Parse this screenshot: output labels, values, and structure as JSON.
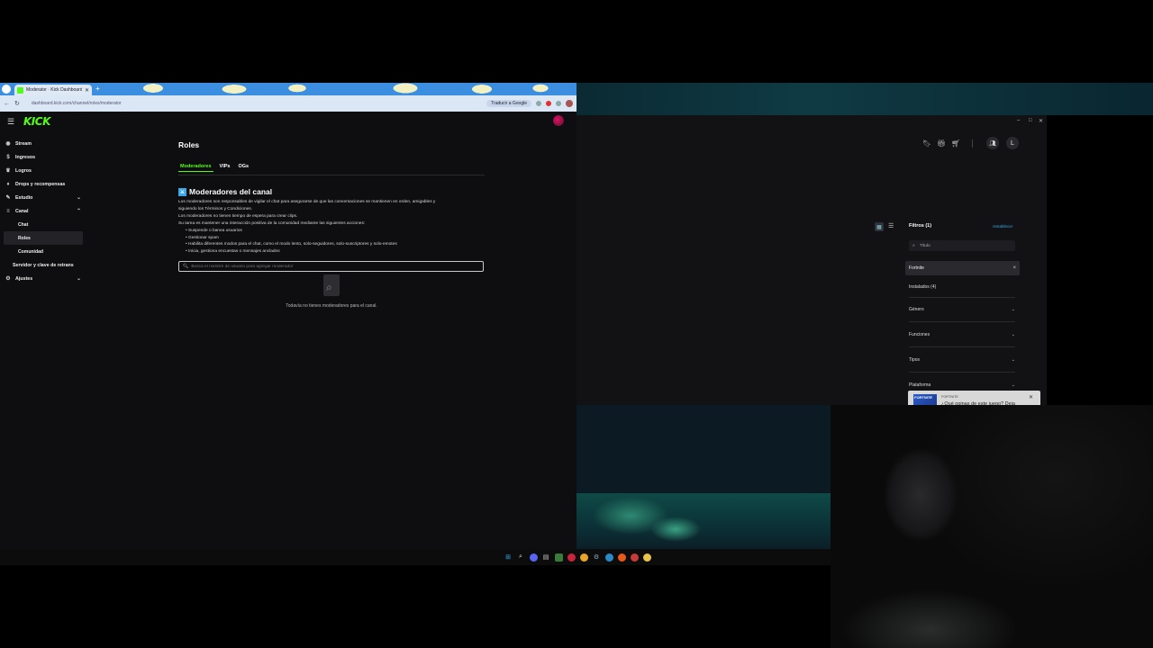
{
  "browser": {
    "tab_title": "Moderator · Kick Dashboard",
    "url": "dashboard.kick.com/channel/roles/moderator",
    "translate_button": "Traducir a Google"
  },
  "kick": {
    "logo": "KICK",
    "sidebar": [
      {
        "label": "Stream",
        "icon": "stream-icon",
        "glyph": "((·))"
      },
      {
        "label": "Ingresos",
        "icon": "money-icon",
        "glyph": "$"
      },
      {
        "label": "Logros",
        "icon": "trophy-icon",
        "glyph": "♛"
      },
      {
        "label": "Drops y recompensas",
        "icon": "gift-icon",
        "glyph": "♦"
      },
      {
        "label": "Estudio",
        "icon": "studio-icon",
        "glyph": "✎"
      },
      {
        "label": "Canal",
        "icon": "channel-icon",
        "glyph": "≡"
      },
      {
        "label": "Chat"
      },
      {
        "label": "Roles"
      },
      {
        "label": "Comunidad"
      },
      {
        "label": "Servidor y clave de retrans"
      },
      {
        "label": "Ajustes",
        "icon": "settings-icon",
        "glyph": "⚙"
      }
    ],
    "page_title": "Roles",
    "tabs": [
      "Moderadores",
      "VIPs",
      "OGs"
    ],
    "section_title": "Moderadores del canal",
    "desc_lines": [
      "Los moderadores son responsables de vigilar el chat para asegurarse de que las conversaciones se mantienen en orden, amigables y",
      "siguiendo los Términos y Condiciones.",
      "Los moderadores no tienen tiempo de espera para crear clips.",
      "Su tarea es mantener una interacción positiva de la comunidad mediante las siguientes acciones:"
    ],
    "bullets": [
      "Suspende o banea usuarios",
      "Gestionar spam",
      "Habilita diferentes modos para el chat, como el modo lento, solo-seguidores, solo-suscriptores y solo-emotes",
      "Inicia, gestiona encuestas o mensajes anclados"
    ],
    "search_placeholder": "Busca el nombre de usuario para agregar moderador",
    "empty_text": "Todavía no tienes moderadores para el canal."
  },
  "launcher": {
    "user_initial": "L",
    "filters_title": "Filtros (1)",
    "reset_label": "restablecer",
    "title_search_placeholder": "Título",
    "active_filter": "Fortnite",
    "installed": "Instalados (4)",
    "filter_groups": [
      "Género",
      "Funciones",
      "Tipos",
      "Plataforma"
    ]
  },
  "toast": {
    "thumb_text": "FORTNITE",
    "game": "FORTNITE",
    "question": "¿Qué opinas de este juego? Deja"
  },
  "colors": {
    "kick_green": "#53fc18",
    "accent_blue": "#3aa7e8"
  }
}
